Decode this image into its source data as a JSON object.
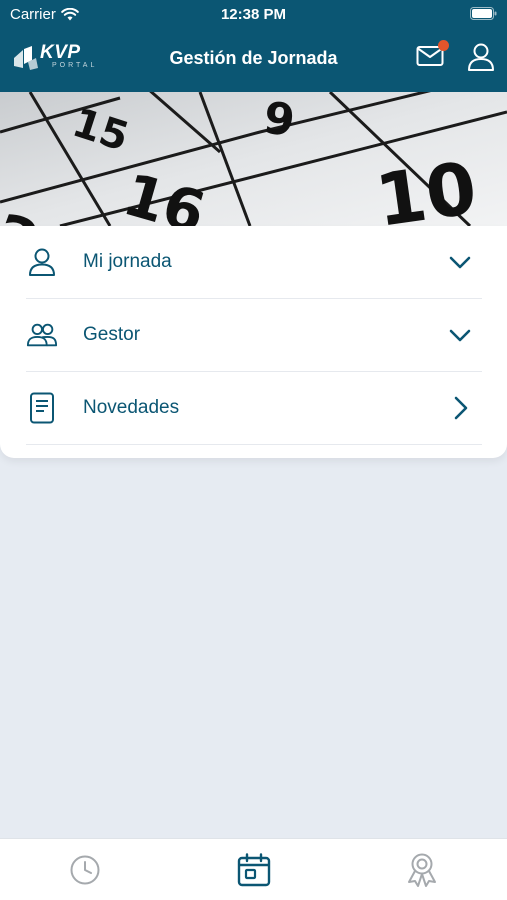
{
  "status_bar": {
    "carrier": "Carrier",
    "time": "12:38 PM",
    "wifi_icon": "wifi-icon",
    "battery_icon": "battery-icon"
  },
  "nav_bar": {
    "logo_text": "KVP",
    "logo_subtext": "PORTAL",
    "title": "Gestión de Jornada",
    "mail_icon": "mail-icon",
    "user_icon": "user-icon",
    "notification_color": "#e2552b"
  },
  "menu": {
    "items": [
      {
        "label": "Mi jornada",
        "icon": "person-icon",
        "chevron": "chevron-down-icon"
      },
      {
        "label": "Gestor",
        "icon": "people-icon",
        "chevron": "chevron-down-icon"
      },
      {
        "label": "Novedades",
        "icon": "document-icon",
        "chevron": "chevron-right-icon"
      }
    ]
  },
  "tab_bar": {
    "tabs": [
      {
        "icon": "clock-icon",
        "active": false
      },
      {
        "icon": "calendar-icon",
        "active": true
      },
      {
        "icon": "award-icon",
        "active": false
      }
    ]
  },
  "colors": {
    "primary": "#0b5673",
    "background": "#e6ebf2",
    "inactive_icon": "#a5a9ad"
  }
}
